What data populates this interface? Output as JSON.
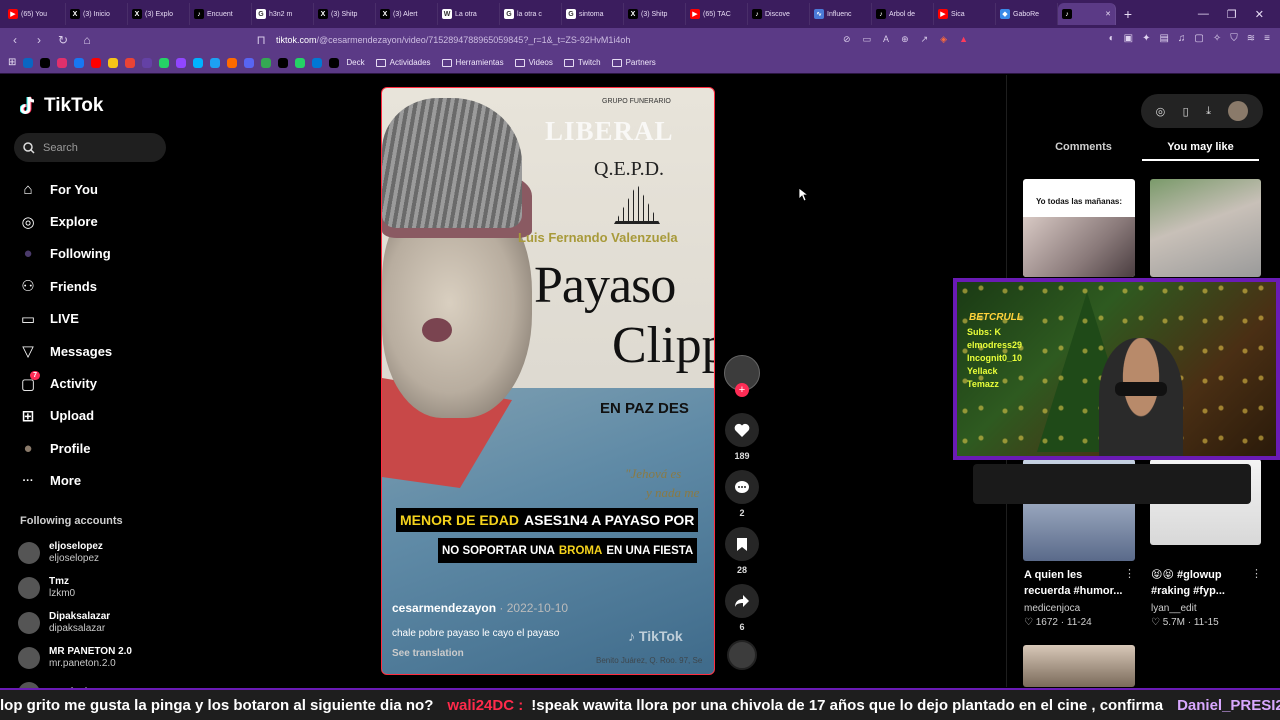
{
  "browser": {
    "tabs": [
      {
        "label": "(65) You",
        "icon": "youtube-icon",
        "color": "#ff0000",
        "glyph": "▶"
      },
      {
        "label": "(3) Inicio",
        "icon": "x-icon",
        "color": "#000000",
        "glyph": "X"
      },
      {
        "label": "(3) Explo",
        "icon": "x-icon",
        "color": "#000000",
        "glyph": "X"
      },
      {
        "label": "Encuent",
        "icon": "tiktok-icon",
        "color": "#000000",
        "glyph": "♪"
      },
      {
        "label": "h3n2 m",
        "icon": "google-icon",
        "color": "#ffffff",
        "glyph": "G"
      },
      {
        "label": "(3) Shitp",
        "icon": "x-icon",
        "color": "#000000",
        "glyph": "X"
      },
      {
        "label": "(3) Alert",
        "icon": "x-icon",
        "color": "#000000",
        "glyph": "X"
      },
      {
        "label": "La otra",
        "icon": "wikipedia-icon",
        "color": "#ffffff",
        "glyph": "W"
      },
      {
        "label": "la otra c",
        "icon": "google-icon",
        "color": "#ffffff",
        "glyph": "G"
      },
      {
        "label": "sintoma",
        "icon": "google-icon",
        "color": "#ffffff",
        "glyph": "G"
      },
      {
        "label": "(3) Shitp",
        "icon": "x-icon",
        "color": "#000000",
        "glyph": "X"
      },
      {
        "label": "(65) TAC",
        "icon": "youtube-icon",
        "color": "#ff0000",
        "glyph": "▶"
      },
      {
        "label": "Discove",
        "icon": "tiktok-icon",
        "color": "#000000",
        "glyph": "♪"
      },
      {
        "label": "Influenc",
        "icon": "link-icon",
        "color": "#4a7ad8",
        "glyph": "∿"
      },
      {
        "label": "Arbol de",
        "icon": "tiktok-icon",
        "color": "#000000",
        "glyph": "♪"
      },
      {
        "label": "Sica",
        "icon": "youtube-icon",
        "color": "#ff0000",
        "glyph": "▶"
      },
      {
        "label": "GaboRe",
        "icon": "shield-icon",
        "color": "#3a8ae8",
        "glyph": "◆"
      },
      {
        "label": "",
        "icon": "tiktok-icon",
        "color": "#000000",
        "glyph": "♪",
        "active": true
      }
    ],
    "url_host": "tiktok.com",
    "url_path": "/@cesarmendezayon/video/7152894788965059845?_r=1&_t=ZS-92HvM1i4oh",
    "bookmarks": {
      "icons": [
        "#0a66c2",
        "#000000",
        "#e1306c",
        "#1877f2",
        "#ff0000",
        "#f5c518",
        "#ea4335",
        "#6441a5",
        "#25d366",
        "#9146ff",
        "#00b2ff",
        "#1da1f2",
        "#ff6a00",
        "#5865f2",
        "#34a853",
        "#000000",
        "#25d366",
        "#0078d4",
        "#000000"
      ],
      "deck_label": "Deck",
      "folders": [
        "Actividades",
        "Herramientas",
        "Videos",
        "Twitch",
        "Partners"
      ]
    }
  },
  "tiktok": {
    "logo_text": "TikTok",
    "search_placeholder": "Search",
    "nav": [
      {
        "label": "For You",
        "icon": "home-icon",
        "glyph": "⌂"
      },
      {
        "label": "Explore",
        "icon": "compass-icon",
        "glyph": "◎"
      },
      {
        "label": "Following",
        "icon": "following-icon",
        "glyph": "●"
      },
      {
        "label": "Friends",
        "icon": "friends-icon",
        "glyph": "⚇"
      },
      {
        "label": "LIVE",
        "icon": "live-icon",
        "glyph": "▭"
      },
      {
        "label": "Messages",
        "icon": "messages-icon",
        "glyph": "▽"
      },
      {
        "label": "Activity",
        "icon": "activity-icon",
        "glyph": "▢",
        "badge": "7"
      },
      {
        "label": "Upload",
        "icon": "upload-icon",
        "glyph": "⊞"
      },
      {
        "label": "Profile",
        "icon": "profile-icon",
        "glyph": "●"
      },
      {
        "label": "More",
        "icon": "more-icon",
        "glyph": "···"
      }
    ],
    "following_title": "Following accounts",
    "following": [
      {
        "name": "eljoselopez",
        "handle": "eljoselopez"
      },
      {
        "name": "Tmz",
        "handle": "lzkm0"
      },
      {
        "name": "Dipaksalazar",
        "handle": "dipaksalazar"
      },
      {
        "name": "MR PANETON 2.0",
        "handle": "mr.paneton.2.0"
      },
      {
        "name": "averfuelunes",
        "handle": ""
      }
    ]
  },
  "video": {
    "overlay": {
      "grupo": "GRUPO FUNERARIO",
      "liberal": "LIBERAL",
      "qepd": "Q.E.P.D.",
      "name": "Luis Fernando Valenzuela",
      "payaso": "Payaso",
      "clipp": "Clipp",
      "en_paz": "EN PAZ DES",
      "quote1": "\"Jehová es",
      "quote2": "y nada me"
    },
    "caption1": {
      "a": "MENOR DE EDAD",
      "b": "ASES1N4 A PAYASO POR"
    },
    "caption2": {
      "a": "NO SOPORTAR UNA",
      "b": "BROMA",
      "c": "EN UNA FIESTA"
    },
    "author": "cesarmendezayon",
    "date": " · 2022-10-10",
    "description": "chale pobre payaso le cayo el payaso",
    "see_translation": "See translation",
    "watermark": "♪ TikTok",
    "watermark_handle": "Benito Juárez, Q. Roo. 97, Se"
  },
  "actions": {
    "likes": "189",
    "comments": "2",
    "saves": "28",
    "shares": "6"
  },
  "right_panel": {
    "tabs": [
      "Comments",
      "You may like"
    ],
    "card1_caption": "Yo todas las mañanas:",
    "cards": [
      {
        "title": "A quien les recuerda #humor...",
        "author": "medicenjoca",
        "meta": "♡ 1672 · 11-24"
      },
      {
        "title": "😝😝 #glowup #raking #fyp...",
        "author": "lyan__edit",
        "meta": "♡ 5.7M · 11-15"
      }
    ]
  },
  "webcam": {
    "brand": "BETCRULL",
    "scribble": [
      "Subs: K",
      "elmodress29",
      "Incognit0_10",
      "Yellack",
      "Temazz"
    ]
  },
  "ticker": {
    "text1": "lop grito me gusta la pinga y los botaron al siguiente dia no?",
    "user1": "wali24DC :",
    "text2": "!speak wawita llora por una chivola de 17 años que lo dejo plantado en el cine , confirma",
    "user2": "Daniel_PRESI23 :"
  }
}
